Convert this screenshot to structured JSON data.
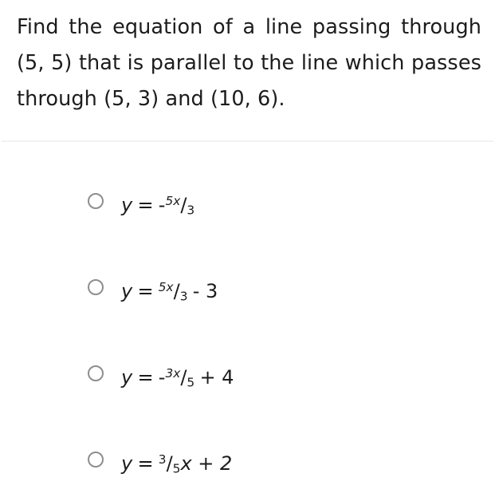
{
  "question": {
    "text": "Find the equation of a line passing through (5, 5) that is parallel to the line which passes through (5, 3) and (10, 6)."
  },
  "divider": {
    "color": "#f1f1f1"
  },
  "colors": {
    "background": "#ffffff",
    "text": "#1c1c1c",
    "radio_border": "#8e8e8e"
  },
  "options": [
    {
      "id": "option-1",
      "plain": "y = -5x/3",
      "selected": false,
      "parts": {
        "lhs": "y",
        "eq": "=",
        "sign": "-",
        "numerator": "5x",
        "slash": "/",
        "denominator": "3",
        "tail": ""
      }
    },
    {
      "id": "option-2",
      "plain": "y = 5x/3 - 3",
      "selected": false,
      "parts": {
        "lhs": "y",
        "eq": "=",
        "sign": "",
        "numerator": "5x",
        "slash": "/",
        "denominator": "3",
        "tail": "- 3"
      }
    },
    {
      "id": "option-3",
      "plain": "y = -3x/5 + 4",
      "selected": false,
      "parts": {
        "lhs": "y",
        "eq": "=",
        "sign": "-",
        "numerator": "3x",
        "slash": "/",
        "denominator": "5",
        "tail": "+ 4"
      }
    },
    {
      "id": "option-4",
      "plain": "y = 3/5x + 2",
      "selected": false,
      "parts": {
        "lhs": "y",
        "eq": "=",
        "sign": "",
        "numerator": "3",
        "slash": "/",
        "denominator": "5",
        "tail": "x + 2"
      }
    }
  ]
}
